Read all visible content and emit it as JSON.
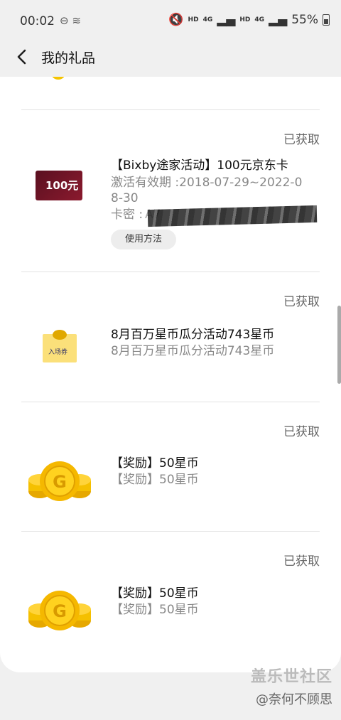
{
  "status_bar": {
    "time": "00:02",
    "signal_labels": [
      "HD",
      "4G",
      "HD",
      "4G"
    ],
    "battery": "55%"
  },
  "header": {
    "title": "我的礼品"
  },
  "gifts": [
    {
      "status": "已获取",
      "name": "【Bixby途家活动】100元京东卡",
      "validity": "激活有效期 :2018-07-29~2022-08-30",
      "card_key_label": "卡密 :",
      "card_key_value": "A7",
      "how_to_use": "使用方法",
      "icon_text": "100元"
    },
    {
      "status": "已获取",
      "name": "8月百万星币瓜分活动743星币",
      "desc": "8月百万星币瓜分活动743星币",
      "icon_text": "入场券"
    },
    {
      "status": "已获取",
      "name": "【奖励】50星币",
      "desc": "【奖励】50星币",
      "icon_text": "G"
    },
    {
      "status": "已获取",
      "name": "【奖励】50星币",
      "desc": "【奖励】50星币",
      "icon_text": "G"
    }
  ],
  "watermark": {
    "site": "盖乐世社区",
    "author": "@奈何不顾思"
  }
}
